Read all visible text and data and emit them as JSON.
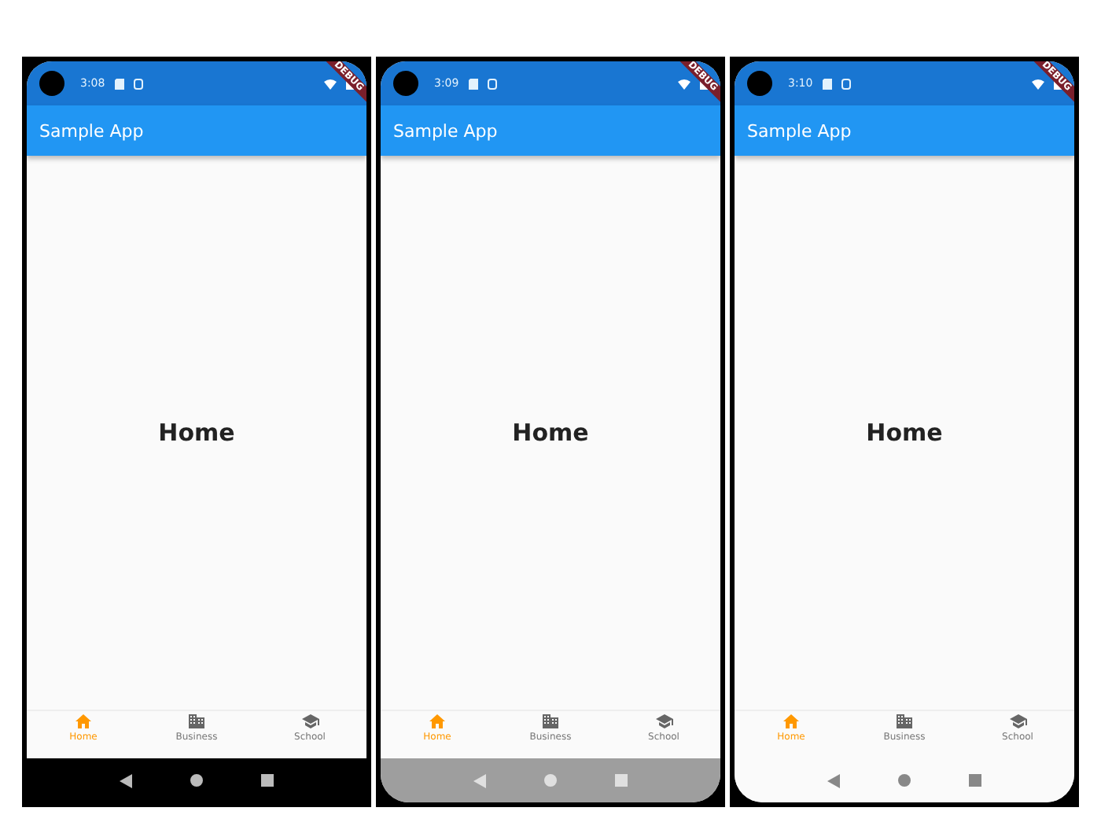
{
  "phones": [
    {
      "time": "3:08",
      "banner": "DEBUG",
      "app_title": "Sample App",
      "body_text": "Home",
      "nav_bar": {
        "kind": "dark"
      },
      "tabs": [
        {
          "label": "Home",
          "kind": "home",
          "selected": true
        },
        {
          "label": "Business",
          "kind": "business",
          "selected": false
        },
        {
          "label": "School",
          "kind": "school",
          "selected": false
        }
      ]
    },
    {
      "time": "3:09",
      "banner": "DEBUG",
      "app_title": "Sample App",
      "body_text": "Home",
      "nav_bar": {
        "kind": "gray"
      },
      "tabs": [
        {
          "label": "Home",
          "kind": "home",
          "selected": true
        },
        {
          "label": "Business",
          "kind": "business",
          "selected": false
        },
        {
          "label": "School",
          "kind": "school",
          "selected": false
        }
      ]
    },
    {
      "time": "3:10",
      "banner": "DEBUG",
      "app_title": "Sample App",
      "body_text": "Home",
      "nav_bar": {
        "kind": "light"
      },
      "tabs": [
        {
          "label": "Home",
          "kind": "home",
          "selected": true
        },
        {
          "label": "Business",
          "kind": "business",
          "selected": false
        },
        {
          "label": "School",
          "kind": "school",
          "selected": false
        }
      ]
    }
  ]
}
